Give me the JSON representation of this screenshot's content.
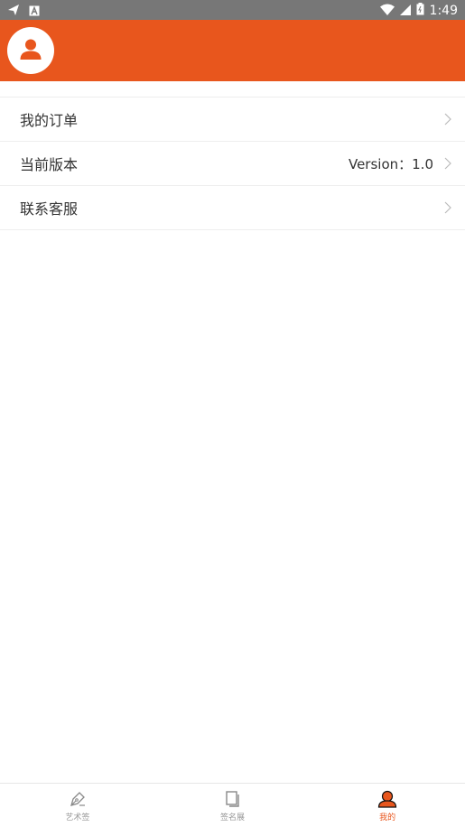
{
  "status_bar": {
    "time": "1:49",
    "icons": [
      "send-icon",
      "notification-a-icon",
      "wifi-icon",
      "signal-icon",
      "battery-icon"
    ]
  },
  "colors": {
    "accent": "#E8561D",
    "status_bar": "#777777",
    "text": "#333333",
    "inactive": "#999999"
  },
  "header": {
    "avatar_icon": "user-icon"
  },
  "menu": {
    "items": [
      {
        "label": "我的订单",
        "value": ""
      },
      {
        "label": "当前版本",
        "value": "Version：1.0"
      },
      {
        "label": "联系客服",
        "value": ""
      }
    ]
  },
  "bottom_nav": {
    "items": [
      {
        "label": "艺术签",
        "icon": "pen-icon",
        "active": false
      },
      {
        "label": "签名展",
        "icon": "pages-icon",
        "active": false
      },
      {
        "label": "我的",
        "icon": "user-icon",
        "active": true
      }
    ]
  }
}
